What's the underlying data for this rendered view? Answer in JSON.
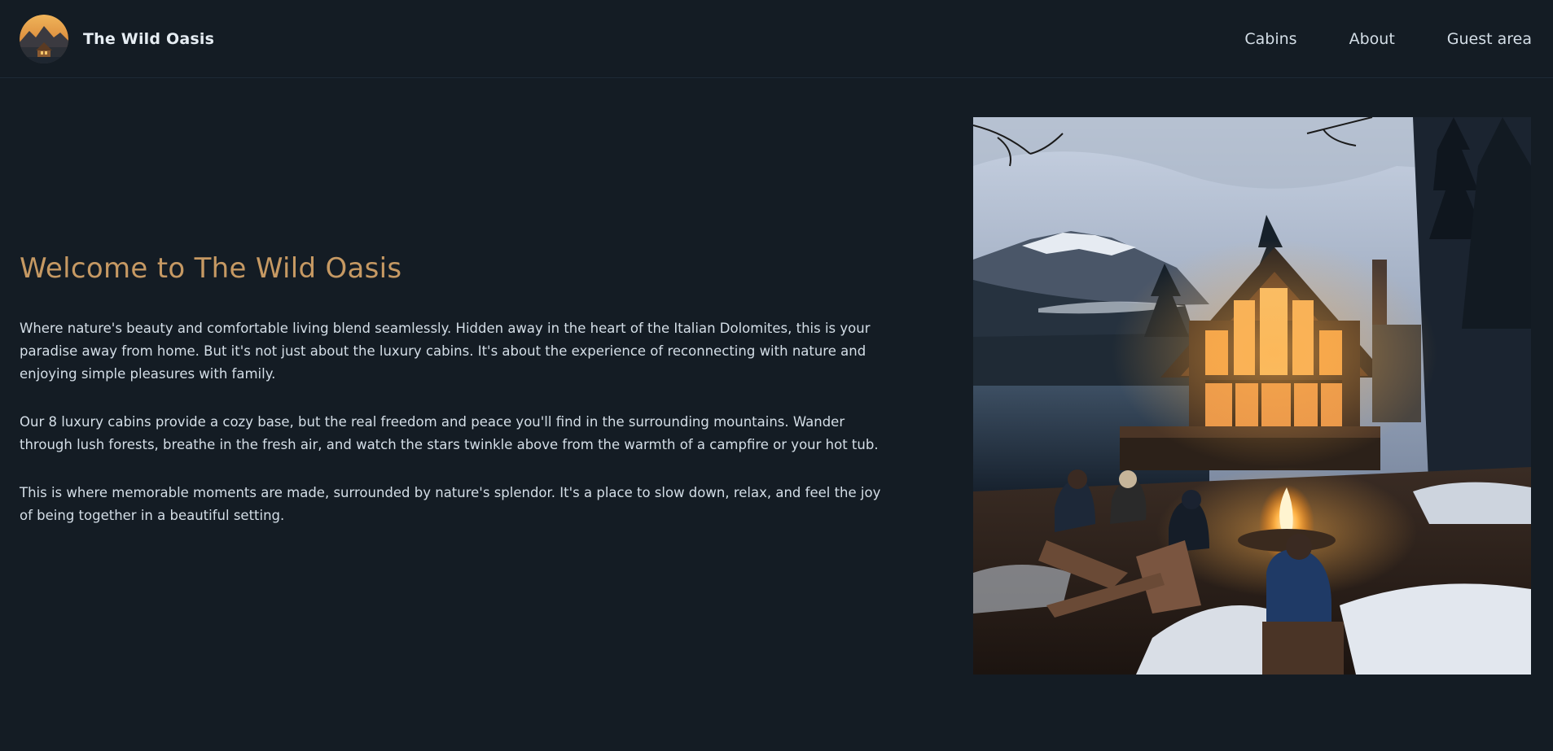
{
  "header": {
    "brand_name": "The Wild Oasis",
    "logo_icon": "cabin-mountain-logo-icon",
    "nav": [
      {
        "label": "Cabins"
      },
      {
        "label": "About"
      },
      {
        "label": "Guest area"
      }
    ]
  },
  "main": {
    "title": "Welcome to The Wild Oasis",
    "paragraphs": [
      "Where nature's beauty and comfortable living blend seamlessly. Hidden away in the heart of the Italian Dolomites, this is your paradise away from home. But it's not just about the luxury cabins. It's about the experience of reconnecting with nature and enjoying simple pleasures with family.",
      "Our 8 luxury cabins provide a cozy base, but the real freedom and peace you'll find in the surrounding mountains. Wander through lush forests, breathe in the fresh air, and watch the stars twinkle above from the warmth of a campfire or your hot tub.",
      "This is where memorable moments are made, surrounded by nature's splendor. It's a place to slow down, relax, and feel the joy of being together in a beautiful setting."
    ],
    "image_subject": "cabin-campfire-photo"
  },
  "colors": {
    "background": "#141c24",
    "accent": "#c69963",
    "text": "#d4dee7"
  }
}
